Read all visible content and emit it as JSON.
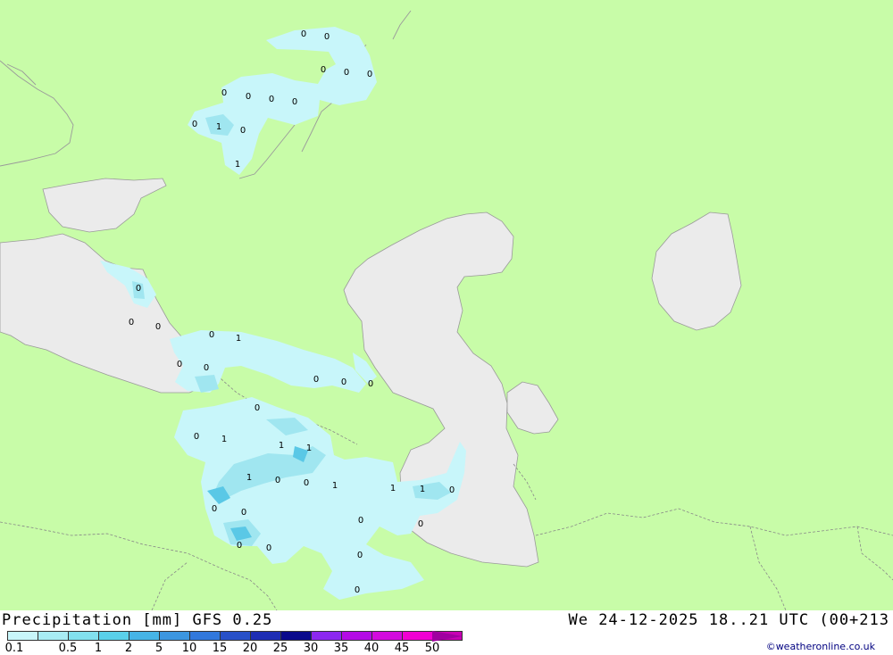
{
  "map": {
    "colors": {
      "land": "#c8fca8",
      "sea": "#ebebeb",
      "precip_light": "#c8f6fa",
      "precip_mid": "#a0e6f0",
      "precip_heavy": "#5ac8e6",
      "border": "#888888"
    },
    "values": [
      "0",
      "0",
      "0",
      "0",
      "0",
      "0",
      "0",
      "0",
      "0",
      "1",
      "0",
      "0",
      "1",
      "0",
      "0",
      "0",
      "0",
      "1",
      "0",
      "0",
      "0",
      "0",
      "0",
      "0",
      "0",
      "1",
      "1",
      "1",
      "1",
      "0",
      "0",
      "1",
      "0",
      "0",
      "0",
      "0",
      "1",
      "1",
      "0",
      "0",
      "0",
      "0",
      "0"
    ]
  },
  "footer": {
    "title_left": "Precipitation [mm]  GFS 0.25",
    "title_right": "We 24-12-2025 18..21 UTC (00+213",
    "credit": "©weatheronline.co.uk"
  },
  "legend": {
    "colors": [
      "#c8f6fa",
      "#a8ecf4",
      "#82e0ee",
      "#5ad0ea",
      "#46b4e6",
      "#3c96e0",
      "#3278dc",
      "#2850c8",
      "#1e2db4",
      "#0a0a8c",
      "#8c28f0",
      "#b40ae6",
      "#d20ade",
      "#f000d2",
      "#c800b4"
    ],
    "labels": [
      "0.1",
      "0.5",
      "1",
      "2",
      "5",
      "10",
      "15",
      "20",
      "25",
      "30",
      "35",
      "40",
      "45",
      "50"
    ]
  }
}
